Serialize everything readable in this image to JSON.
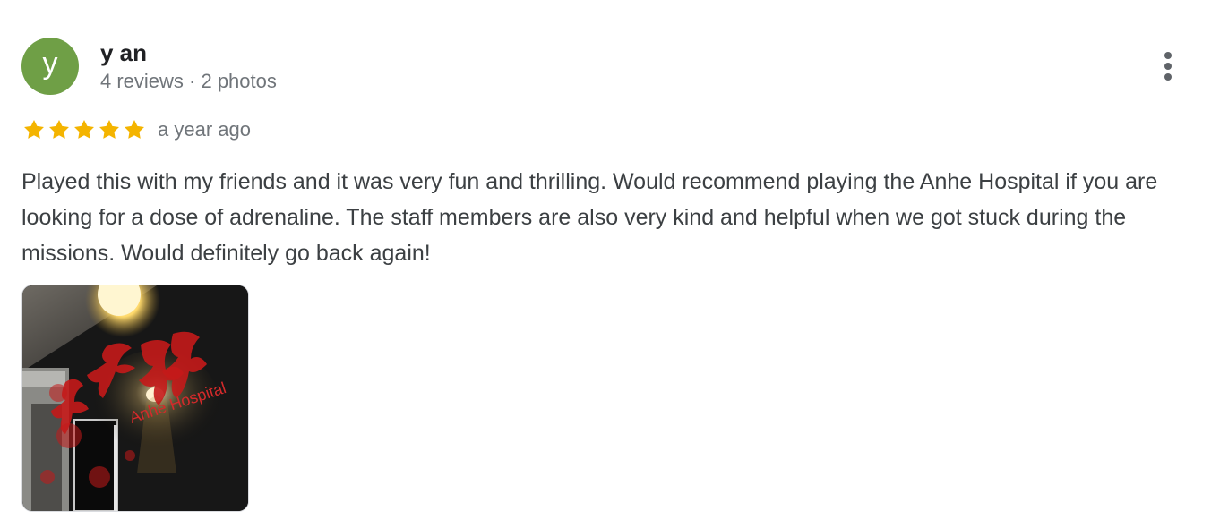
{
  "review": {
    "avatar_letter": "y",
    "avatar_color": "#6f9f46",
    "author_name": "y an",
    "author_meta": "4 reviews · 2 photos",
    "rating": 5,
    "rating_max": 5,
    "star_color": "#f4b400",
    "date": "a year ago",
    "text": "Played this with my friends and it was very fun and thrilling. Would recommend playing the Anhe Hospital if you are looking for a dose of adrenaline. The staff members are also very kind and helpful when we got stuck during the missions. Would definitely go back again!",
    "photo": {
      "sign_text": "Anhe Hospital"
    },
    "more_options_icon": "more-vertical-icon"
  }
}
